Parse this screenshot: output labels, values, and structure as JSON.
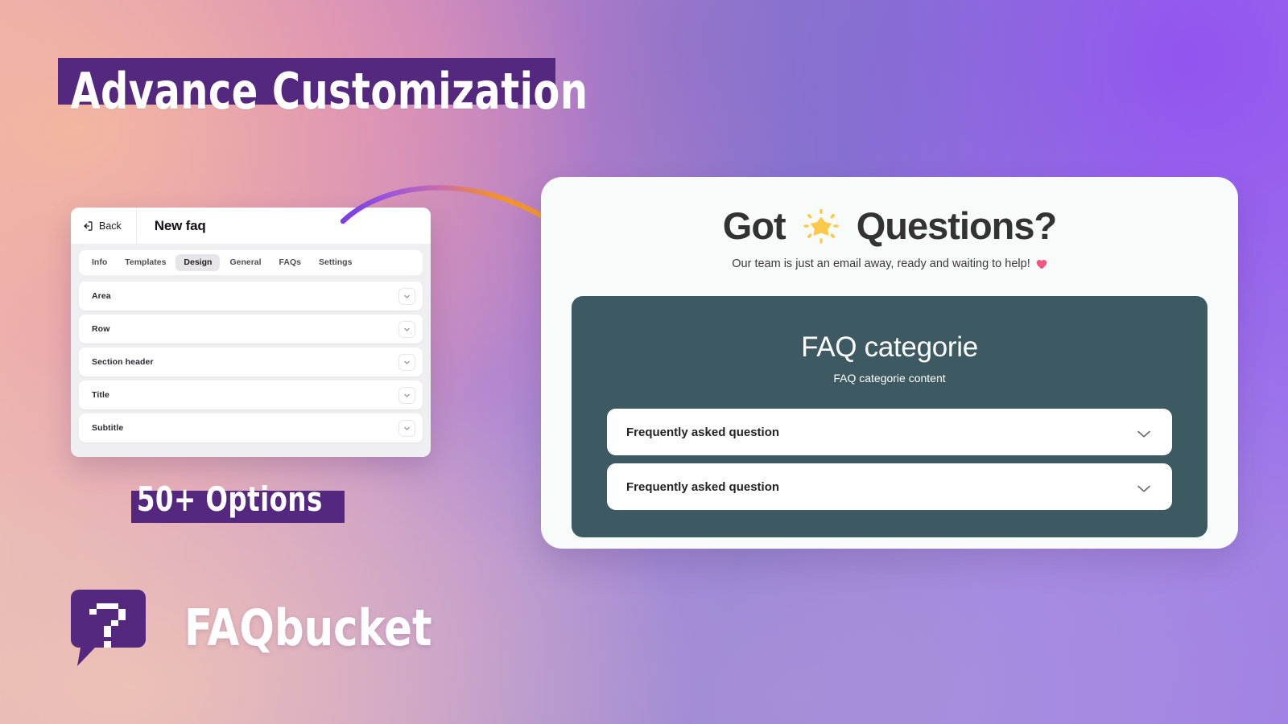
{
  "headline": {
    "title": "Advance Customization",
    "options_badge": "50+ Options",
    "banner_color": "#54287f"
  },
  "app": {
    "back_label": "Back",
    "back_icon": "exit-arrow-icon",
    "page_title": "New faq",
    "tabs": [
      {
        "label": "Info",
        "active": false
      },
      {
        "label": "Templates",
        "active": false
      },
      {
        "label": "Design",
        "active": true
      },
      {
        "label": "General",
        "active": false
      },
      {
        "label": "FAQs",
        "active": false
      },
      {
        "label": "Settings",
        "active": false
      }
    ],
    "sections": [
      {
        "label": "Area",
        "expander_icon": "chevron-down-icon"
      },
      {
        "label": "Row",
        "expander_icon": "chevron-down-icon"
      },
      {
        "label": "Section header",
        "expander_icon": "chevron-down-icon"
      },
      {
        "label": "Title",
        "expander_icon": "chevron-down-icon"
      },
      {
        "label": "Subtitle",
        "expander_icon": "chevron-down-icon"
      }
    ]
  },
  "preview": {
    "title_before": "Got",
    "title_emoji": "glowing-star-emoji",
    "title_after": "Questions?",
    "subtitle": "Our team is just an email away, ready and waiting to help!",
    "subtitle_emoji": "heart-emoji",
    "category": {
      "title": "FAQ categorie",
      "subtitle": "FAQ categorie content",
      "background_color": "#3d5a63"
    },
    "faqs": [
      {
        "question": "Frequently asked question",
        "toggle_icon": "chevron-down-icon"
      },
      {
        "question": "Frequently asked question",
        "toggle_icon": "chevron-down-icon"
      }
    ]
  },
  "brand": {
    "name": "FAQbucket",
    "logo_icon": "question-mark-speech-bubble-icon",
    "logo_color": "#54287f"
  }
}
